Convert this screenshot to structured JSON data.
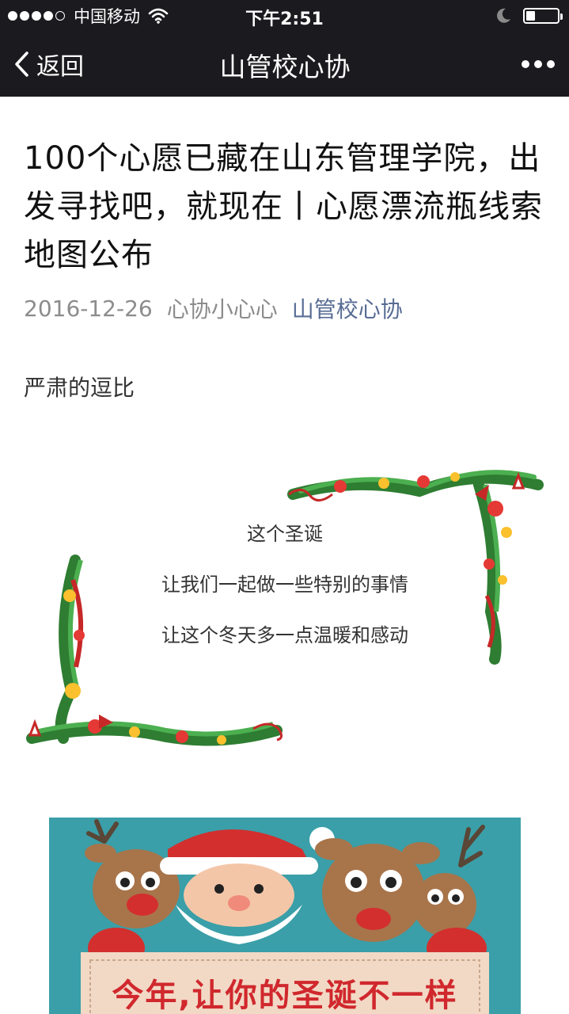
{
  "status_bar": {
    "carrier": "中国移动",
    "time": "下午2:51",
    "signal_bars": 4,
    "battery_level": 0.3
  },
  "nav": {
    "back_label": "返回",
    "title": "山管校心协"
  },
  "article": {
    "title": "100个心愿已藏在山东管理学院，出发寻找吧，就现在丨心愿漂流瓶线索地图公布",
    "date": "2016-12-26",
    "author": "心协小心心",
    "account": "山管校心协",
    "intro": "严肃的逗比",
    "card_lines": [
      "这个圣诞",
      "让我们一起做一些特别的事情",
      "让这个冬天多一点温暖和感动"
    ],
    "poster_caption": "今年,让你的圣诞不一样"
  },
  "colors": {
    "bar_bg": "#1b1b1f",
    "link": "#586c94",
    "meta_gray": "#8c8c8c",
    "poster_teal": "#3a9fa8",
    "poster_red": "#d0282d"
  },
  "icons": [
    "wifi-icon",
    "moon-icon",
    "battery-icon",
    "back-chevron-icon",
    "more-icon"
  ]
}
